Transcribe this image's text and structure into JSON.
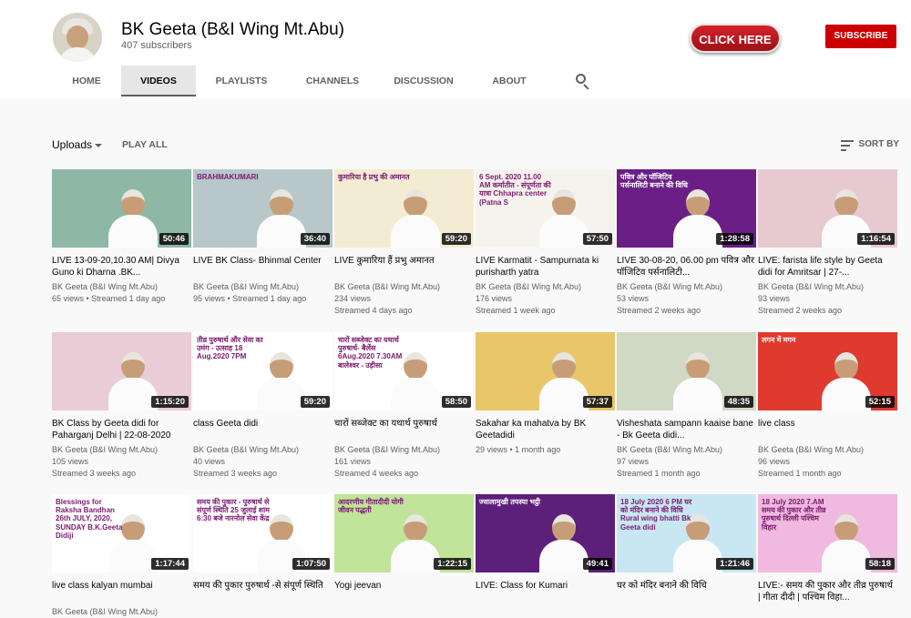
{
  "channel": {
    "name": "BK Geeta (B&I Wing Mt.Abu)",
    "subscribers": "407 subscribers",
    "promo_label": "CLICK HERE",
    "subscribe_label": "SUBSCRIBE"
  },
  "tabs": [
    "HOME",
    "VIDEOS",
    "PLAYLISTS",
    "CHANNELS",
    "DISCUSSION",
    "ABOUT"
  ],
  "toolbar": {
    "uploads_label": "Uploads",
    "play_all_label": "PLAY ALL",
    "sort_label": "SORT BY"
  },
  "videos": [
    {
      "title": "LIVE 13-09-20,10.30 AM| Divya Guno ki Dharna .BK...",
      "channel": "BK Geeta (B&I Wing Mt.Abu)",
      "stats": "65 views • Streamed 1 day ago",
      "stats2": "",
      "duration": "50:46",
      "thumb_text": "",
      "color": "#8fb7a6"
    },
    {
      "title": "LIVE BK Class- Bhinmal Center",
      "channel": "BK Geeta (B&I Wing Mt.Abu)",
      "stats": "95 views • Streamed 1 day ago",
      "stats2": "",
      "duration": "36:40",
      "thumb_text": "BRAHMAKUMARI",
      "color": "#b8c7c9"
    },
    {
      "title": "LIVE कुमारिया हैं प्रभु अमानत",
      "channel": "BK Geeta (B&I Wing Mt.Abu)",
      "stats": "234 views",
      "stats2": "Streamed 4 days ago",
      "duration": "59:20",
      "thumb_text": "कुमारिया है प्रभु की अमानत",
      "color": "#f4ecd2"
    },
    {
      "title": "LIVE Karmatit - Sampurnata ki purisharth yatra",
      "channel": "BK Geeta (B&I Wing Mt.Abu)",
      "stats": "176 views",
      "stats2": "Streamed 1 week ago",
      "duration": "57:50",
      "thumb_text": "6 Sept. 2020 11.00 AM कर्मातीत - संपूर्णता की यात्रा Chhapra center (Patna S",
      "color": "#f6f3ee"
    },
    {
      "title": "LIVE 30-08-20, 06.00 pm पवित्र और पॉजिटिव पर्सनालिटी...",
      "channel": "BK Geeta (B&I Wing Mt.Abu)",
      "stats": "53 views",
      "stats2": "Streamed 2 weeks ago",
      "duration": "1:28:58",
      "thumb_text": "पवित्र और पॉजिटिव पर्सनालिटी बनाने की विधि",
      "color": "#6b1f86"
    },
    {
      "title": "LIVE: farista life style by Geeta didi for Amritsar | 27-...",
      "channel": "BK Geeta (B&I Wing Mt.Abu)",
      "stats": "93 views",
      "stats2": "Streamed 2 weeks ago",
      "duration": "1:16:54",
      "thumb_text": "",
      "color": "#e7c9d0"
    },
    {
      "title": "BK Class by Geeta didi for Paharganj Delhi | 22-08-2020",
      "channel": "BK Geeta (B&I Wing Mt.Abu)",
      "stats": "105 views",
      "stats2": "Streamed 3 weeks ago",
      "duration": "1:15:20",
      "thumb_text": "",
      "color": "#e8cdd6"
    },
    {
      "title": "class Geeta didi",
      "channel": "BK Geeta (B&I Wing Mt.Abu)",
      "stats": "40 views",
      "stats2": "Streamed 3 weeks ago",
      "duration": "59:20",
      "thumb_text": "तीव्र पुरुषार्थ और सेवा का उमंग - उत्साह 18 Aug.2020 7PM",
      "color": "#ffffff"
    },
    {
      "title": "चारों सब्जेक्ट का यथार्थ पुरुषार्थ",
      "channel": "BK Geeta (B&I Wing Mt.Abu)",
      "stats": "161 views",
      "stats2": "Streamed 4 weeks ago",
      "duration": "58:50",
      "thumb_text": "चारों सब्जेक्ट का यथार्थ पुरुषार्थ- बैलेंस 6Aug.2020 7.30AM बालेश्वर - उड़ीसा",
      "color": "#ffffff"
    },
    {
      "title": "Sakahar ka mahatva by BK Geetadidi",
      "channel": "",
      "stats": "29 views • 1 month ago",
      "stats2": "",
      "duration": "57:37",
      "thumb_text": "",
      "color": "#e9c66a"
    },
    {
      "title": "Visheshata sampann kaaise bane - Bk Geeta didi...",
      "channel": "BK Geeta (B&I Wing Mt.Abu)",
      "stats": "97 views",
      "stats2": "Streamed 1 month ago",
      "duration": "48:35",
      "thumb_text": "",
      "color": "#cfd9c4"
    },
    {
      "title": "live class",
      "channel": "BK Geeta (B&I Wing Mt.Abu)",
      "stats": "96 views",
      "stats2": "Streamed 1 month ago",
      "duration": "52:15",
      "thumb_text": "लगन में मगन",
      "color": "#e0392e"
    },
    {
      "title": "live class kalyan mumbai",
      "channel": "BK Geeta (B&I Wing Mt.Abu)",
      "stats": "",
      "stats2": "",
      "duration": "1:17:44",
      "thumb_text": "Blessings for Raksha Bandhan 26th JULY, 2020, SUNDAY B.K.Geeta Didiji",
      "color": "#ffffff"
    },
    {
      "title": "समय की पुकार पुरुषार्थ -से संपूर्ण स्थिति",
      "channel": "",
      "stats": "",
      "stats2": "",
      "duration": "1:07:50",
      "thumb_text": "समय की पुकार - पुरुषार्थ से संपूर्ण स्थिति 25 जुलाई शाम 6:30 बजे नारनोल सेवा केंद्र",
      "color": "#ffffff"
    },
    {
      "title": "Yogi jeevan",
      "channel": "",
      "stats": "",
      "stats2": "",
      "duration": "1:22:15",
      "thumb_text": "आदरणीय गीतादीदी योगी जीवन पद्धती",
      "color": "#bfe49a"
    },
    {
      "title": "LIVE: Class for Kumari",
      "channel": "",
      "stats": "",
      "stats2": "",
      "duration": "49:41",
      "thumb_text": "ज्वालामुखी तपस्या भट्ठी",
      "color": "#5c1f7a"
    },
    {
      "title": "घर को मंदिर बनाने की विधि",
      "channel": "",
      "stats": "",
      "stats2": "",
      "duration": "1:21:46",
      "thumb_text": "18 July 2020 6 PM घर को मंदिर बनाने की विधि Rural wing bhatti Bk Geeta didi",
      "color": "#c9e7f3"
    },
    {
      "title": "LIVE:- समय की पुकार और तीव्र पुरुषार्थ | गीता दीदी | पश्चिम विहा...",
      "channel": "",
      "stats": "",
      "stats2": "",
      "duration": "58:18",
      "thumb_text": "18 July 2020 7.AM समय की पुकार और तीव्र पुरुषार्थ दिल्ली पश्चिम विहार",
      "color": "#f0b9df"
    }
  ]
}
